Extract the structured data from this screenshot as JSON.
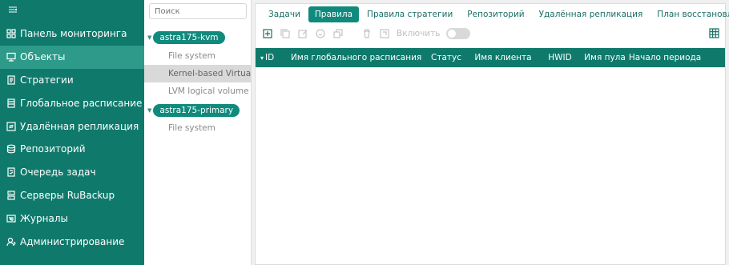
{
  "sidebar": {
    "items": [
      {
        "label": "Панель мониторинга",
        "icon": "dashboard-icon"
      },
      {
        "label": "Объекты",
        "icon": "monitor-icon",
        "active": true
      },
      {
        "label": "Стратегии",
        "icon": "document-icon"
      },
      {
        "label": "Глобальное расписание",
        "icon": "schedule-icon"
      },
      {
        "label": "Удалённая репликация",
        "icon": "replication-icon"
      },
      {
        "label": "Репозиторий",
        "icon": "database-icon"
      },
      {
        "label": "Очередь задач",
        "icon": "queue-icon"
      },
      {
        "label": "Серверы RuBackup",
        "icon": "server-icon"
      },
      {
        "label": "Журналы",
        "icon": "log-icon"
      },
      {
        "label": "Администрирование",
        "icon": "admin-icon"
      }
    ]
  },
  "tree": {
    "search_placeholder": "Поиск",
    "nodes": [
      {
        "type": "host",
        "label": "astra175-kvm"
      },
      {
        "type": "child",
        "label": "File system"
      },
      {
        "type": "child",
        "label": "Kernel-based Virtual Machine",
        "selected": true
      },
      {
        "type": "child",
        "label": "LVM logical volume"
      },
      {
        "type": "host",
        "label": "astra175-primary"
      },
      {
        "type": "child",
        "label": "File system"
      }
    ]
  },
  "tabs": [
    {
      "label": "Задачи"
    },
    {
      "label": "Правила",
      "active": true
    },
    {
      "label": "Правила стратегии"
    },
    {
      "label": "Репозиторий"
    },
    {
      "label": "Удалённая репликация"
    },
    {
      "label": "План восстановления"
    }
  ],
  "toolbar": {
    "enable_label": "Включить"
  },
  "table": {
    "columns": [
      "ID",
      "Имя глобального расписания",
      "Статус",
      "Имя клиента",
      "HWID",
      "Имя пула",
      "Начало периода"
    ]
  },
  "colors": {
    "sidebar_bg": "#0f7a6c",
    "accent": "#0f8a7c"
  }
}
